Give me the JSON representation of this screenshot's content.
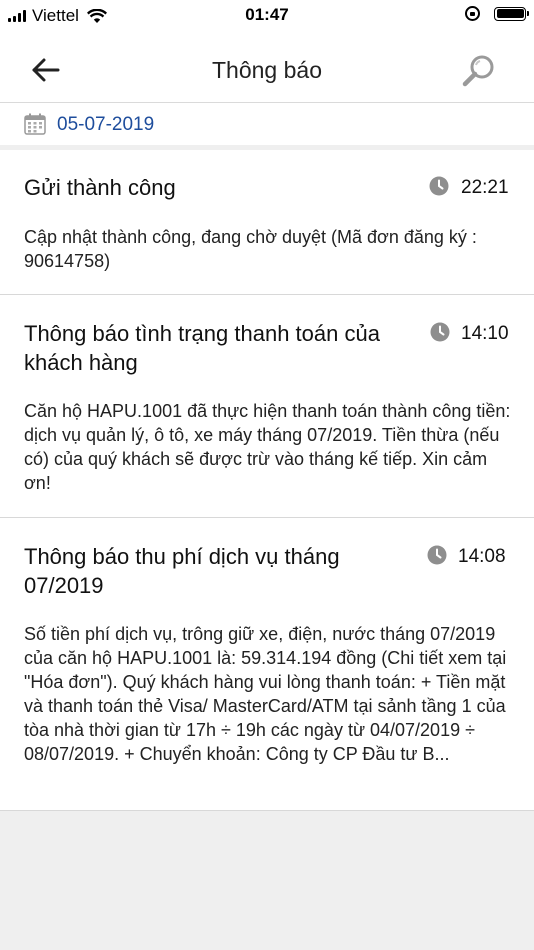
{
  "status_bar": {
    "carrier": "Viettel",
    "time": "01:47"
  },
  "header": {
    "title": "Thông báo",
    "back_icon": "arrow-left-icon",
    "search_icon": "search-icon"
  },
  "date_filter": {
    "date": "05-07-2019",
    "icon": "calendar-icon"
  },
  "notifications": [
    {
      "title": "Gửi thành công",
      "time": "22:21",
      "body": "Cập nhật thành công, đang chờ duyệt (Mã đơn đăng ký : 90614758)"
    },
    {
      "title": "Thông báo tình trạng thanh toán của khách hàng",
      "time": "14:10",
      "body": "Căn hộ HAPU.1001 đã thực hiện thanh toán thành công tiền: dịch vụ quản lý, ô tô, xe máy tháng 07/2019. Tiền thừa (nếu có) của quý khách sẽ được trừ vào tháng kế tiếp. Xin cảm ơn!"
    },
    {
      "title": "Thông báo thu phí dịch vụ tháng 07/2019",
      "time": "14:08",
      "body": "Số tiền phí dịch vụ, trông giữ xe, điện, nước tháng 07/2019 của căn hộ HAPU.1001 là: 59.314.194 đồng (Chi tiết xem tại \"Hóa đơn\"). Quý khách hàng vui lòng thanh toán: + Tiền mặt và thanh toán thẻ Visa/ MasterCard/ATM tại sảnh tầng 1 của tòa nhà thời gian từ 17h ÷ 19h các ngày từ 04/07/2019 ÷ 08/07/2019. + Chuyển khoản: Công ty CP Đầu tư B..."
    }
  ],
  "colors": {
    "accent": "#1e4d9c",
    "background": "#efefef",
    "icon_gray": "#8e8e8e"
  }
}
